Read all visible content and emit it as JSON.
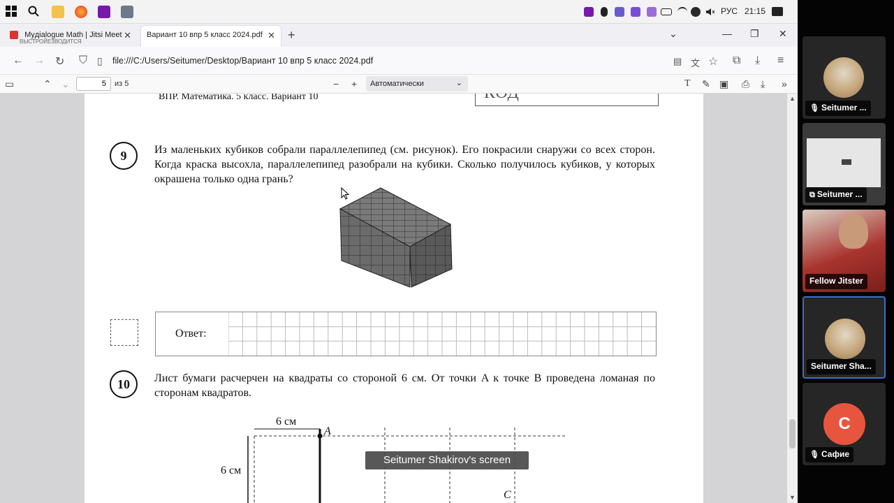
{
  "taskbar": {
    "language": "РУС",
    "time": "21:15"
  },
  "tabs": [
    {
      "label": "Myдialogue Math | Jitsi Meet",
      "sublabel": "ВЫСТРОЙЕЗВОДИТСЯ"
    },
    {
      "label": "Вариант 10 впр 5 класс 2024.pdf"
    }
  ],
  "navbar": {
    "url": "file:///C:/Users/Seitumer/Desktop/Вариант 10 впр 5 класс 2024.pdf"
  },
  "pdf_toolbar": {
    "page_number": "5",
    "page_of": "из 5",
    "zoom": "Автоматически"
  },
  "document": {
    "header": "ВПР. Математика. 5 класс. Вариант 10",
    "code_label": "КОД",
    "q9": {
      "number": "9",
      "text": "Из маленьких кубиков собрали параллелепипед (см. рисунок). Его покрасили снаружи со всех сторон. Когда краска высохла, параллелепипед разобрали на кубики. Сколько получилось кубиков, у которых окрашена только одна грань?"
    },
    "answer_label": "Ответ:",
    "q10": {
      "number": "10",
      "text": "Лист бумаги расчерчен на квадраты со стороной 6 см. От точки A к точке B проведена ломаная по сторонам квадратов."
    },
    "figure": {
      "top_label": "6 см",
      "side_label": "6 см",
      "point_a": "A",
      "point_c": "C"
    }
  },
  "screen_caption": "Seitumer Shakirov's screen",
  "participants": [
    {
      "name": "Seitumer ...",
      "kind": "photo",
      "muted": true
    },
    {
      "name": "Seitumer ...",
      "kind": "screen",
      "muted": false
    },
    {
      "name": "Fellow Jitster",
      "kind": "video",
      "muted": false
    },
    {
      "name": "Seitumer Sha...",
      "kind": "photo",
      "active": true
    },
    {
      "name": "Сафие",
      "kind": "letter",
      "letter": "С",
      "color": "#e8553e",
      "muted": true
    }
  ]
}
